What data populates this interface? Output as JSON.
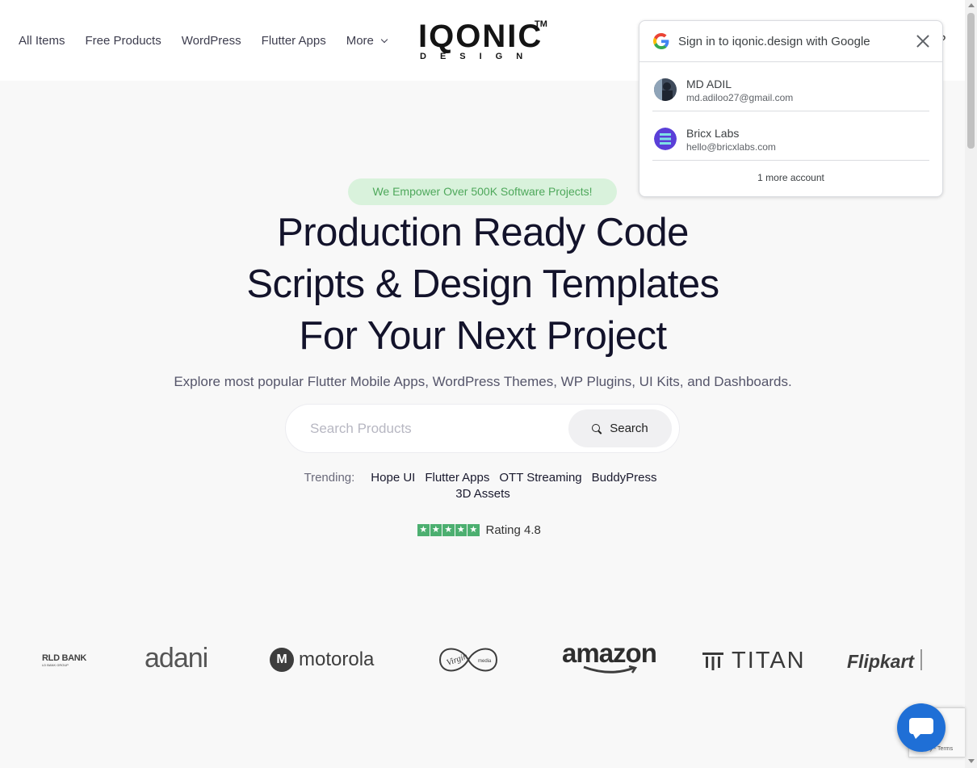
{
  "nav": {
    "items": [
      "All Items",
      "Free Products",
      "WordPress",
      "Flutter Apps"
    ],
    "more_label": "More"
  },
  "logo": {
    "main": "IQONIC",
    "tm": "TM",
    "sub": "DESIGN"
  },
  "google_popup": {
    "title": "Sign in to iqonic.design with Google",
    "accounts": [
      {
        "name": "MD ADIL",
        "email": "md.adiloo27@gmail.com"
      },
      {
        "name": "Bricx Labs",
        "email": "hello@bricxlabs.com"
      }
    ],
    "more_accounts": "1 more account"
  },
  "hero": {
    "badge": "We Empower Over 500K Software Projects!",
    "title_lines": [
      "Production Ready Code",
      "Scripts & Design Templates",
      "For Your Next Project"
    ],
    "subtitle": "Explore most popular Flutter Mobile Apps, WordPress Themes, WP Plugins, UI Kits, and Dashboards."
  },
  "search": {
    "placeholder": "Search Products",
    "button_label": "Search"
  },
  "trending": {
    "label": "Trending:",
    "tags": [
      "Hope UI",
      "Flutter Apps",
      "OTT Streaming",
      "BuddyPress",
      "3D Assets"
    ]
  },
  "rating": {
    "label": "Rating 4.8",
    "stars": 5
  },
  "brands": {
    "world_bank": "RLD BANK",
    "world_bank_sub": "LD BANK GROUP",
    "adani": "adani",
    "motorola": "motorola",
    "amazon": "amazon",
    "titan": "TITAN",
    "flipkart": "Flipkart"
  },
  "recaptcha": {
    "text": "Privacy - Terms"
  },
  "colors": {
    "badge_bg": "#d9f2dc",
    "badge_text": "#4ea85b",
    "star_green": "#4caf70",
    "chat_blue": "#1f6fd6",
    "logo_accent": "#c7823d"
  }
}
